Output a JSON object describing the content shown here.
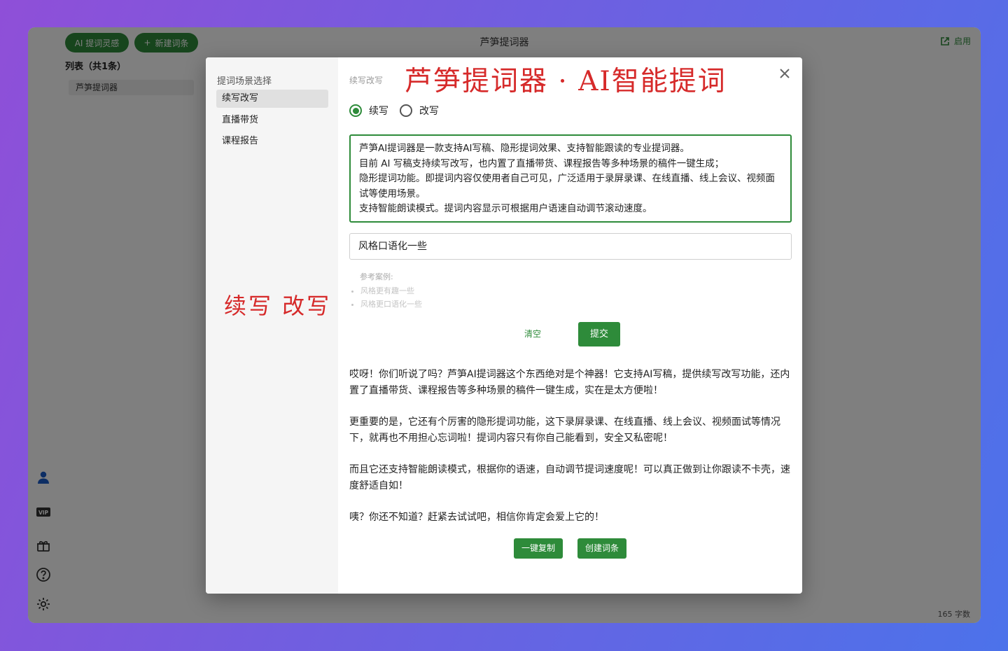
{
  "app": {
    "title": "芦笋提词器",
    "ai_button": "AI 提词灵感",
    "new_button": "新建词条",
    "launch": "启用",
    "list_title": "列表（共1条）",
    "list_items": [
      "芦笋提词器"
    ],
    "word_count": "165 字数"
  },
  "annotations": {
    "title": "芦笋提词器 · AI智能提词",
    "subtitle": "续写 改写"
  },
  "modal": {
    "scene_title": "提词场景选择",
    "scenes": [
      "续写改写",
      "直播带货",
      "课程报告"
    ],
    "active_scene": 0,
    "title": "续写改写",
    "radio_options": [
      "续写",
      "改写"
    ],
    "radio_selected": 0,
    "source_lines": [
      "芦笋AI提词器是一款支持AI写稿、隐形提词效果、支持智能跟读的专业提词器。",
      "目前 AI 写稿支持续写改写，也内置了直播带货、课程报告等多种场景的稿件一键生成；",
      "隐形提词功能。即提词内容仅使用者自己可见，广泛适用于录屏录课、在线直播、线上会议、视频面试等使用场景。",
      "支持智能朗读模式。提词内容显示可根据用户语速自动调节滚动速度。"
    ],
    "style_value": "风格口语化一些",
    "reference_label": "参考案例:",
    "references": [
      "风格更有趣一些",
      "风格更口语化一些"
    ],
    "clear_label": "清空",
    "submit_label": "提交",
    "output_paragraphs": [
      "哎呀！你们听说了吗？芦笋AI提词器这个东西绝对是个神器！它支持AI写稿，提供续写改写功能，还内置了直播带货、课程报告等多种场景的稿件一键生成，实在是太方便啦！",
      "更重要的是，它还有个厉害的隐形提词功能，这下录屏录课、在线直播、线上会议、视频面试等情况下，就再也不用担心忘词啦！提词内容只有你自己能看到，安全又私密呢！",
      "而且它还支持智能朗读模式，根据你的语速，自动调节提词速度呢！可以真正做到让你跟读不卡壳，速度舒适自如！",
      "咦？你还不知道？赶紧去试试吧，相信你肯定会爱上它的！"
    ],
    "copy_label": "一键复制",
    "create_label": "创建词条"
  },
  "colors": {
    "accent": "#2e8b3a",
    "annotation": "#d62a2a",
    "background_start": "#8f4fd8",
    "background_end": "#4c72ea"
  }
}
